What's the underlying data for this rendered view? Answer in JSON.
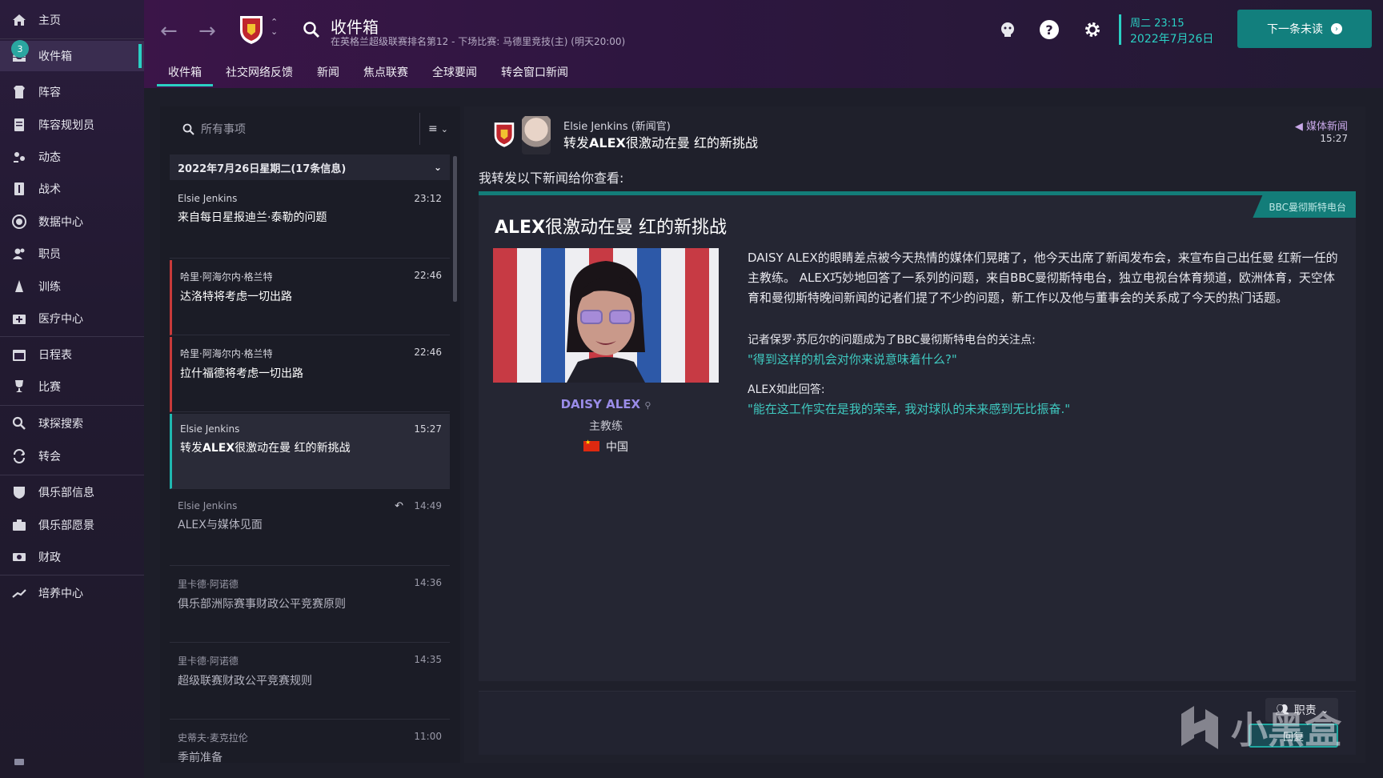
{
  "sidebar": {
    "items": [
      {
        "label": "主页",
        "icon": "home-icon"
      },
      {
        "label": "收件箱",
        "icon": "inbox-icon",
        "badge": "3",
        "active": true
      },
      {
        "label": "阵容",
        "icon": "squad-icon"
      },
      {
        "label": "阵容规划员",
        "icon": "planner-icon"
      },
      {
        "label": "动态",
        "icon": "dynamics-icon"
      },
      {
        "label": "战术",
        "icon": "tactics-icon"
      },
      {
        "label": "数据中心",
        "icon": "data-hub-icon"
      },
      {
        "label": "职员",
        "icon": "staff-icon"
      },
      {
        "label": "训练",
        "icon": "training-icon"
      },
      {
        "label": "医疗中心",
        "icon": "medical-icon"
      },
      {
        "label": "日程表",
        "icon": "calendar-icon"
      },
      {
        "label": "比赛",
        "icon": "trophy-icon"
      },
      {
        "label": "球探搜索",
        "icon": "scouting-icon"
      },
      {
        "label": "转会",
        "icon": "transfer-icon"
      },
      {
        "label": "俱乐部信息",
        "icon": "club-info-icon"
      },
      {
        "label": "俱乐部愿景",
        "icon": "club-vision-icon"
      },
      {
        "label": "财政",
        "icon": "finance-icon"
      },
      {
        "label": "培养中心",
        "icon": "development-icon"
      }
    ]
  },
  "header": {
    "title": "收件箱",
    "subtitle": "在英格兰超级联赛排名第12 - 下场比赛: 马德里竞技(主) (明天20:00)",
    "tabs": [
      "收件箱",
      "社交网络反馈",
      "新闻",
      "焦点联赛",
      "全球要闻",
      "转会窗口新闻"
    ],
    "active_tab": "收件箱",
    "date_line1": "周二 23:15",
    "date_line2": "2022年7月26日",
    "next_button": "下一条未读"
  },
  "inbox": {
    "search_placeholder": "所有事项",
    "group_header": "2022年7月26日星期二(17条信息)",
    "messages": [
      {
        "from": "Elsie Jenkins",
        "subject": "来自每日星报迪兰·泰勒的问题",
        "time": "23:12",
        "state": "new"
      },
      {
        "from": "哈里·阿海尔内·格兰特",
        "subject": "达洛特将考虑一切出路",
        "time": "22:46",
        "state": "unread"
      },
      {
        "from": "哈里·阿海尔内·格兰特",
        "subject": "拉什福德将考虑一切出路",
        "time": "22:46",
        "state": "unread"
      },
      {
        "from": "Elsie Jenkins",
        "subject_pre": "转发",
        "subject_bold": "ALEX",
        "subject_post": "很激动在曼 红的新挑战",
        "time": "15:27",
        "state": "selected"
      },
      {
        "from": "Elsie Jenkins",
        "subject": "ALEX与媒体见面",
        "time": "14:49",
        "state": "read",
        "replied": true
      },
      {
        "from": "里卡德·阿诺德",
        "subject": "俱乐部洲际赛事财政公平竞赛原则",
        "time": "14:36",
        "state": "read"
      },
      {
        "from": "里卡德·阿诺德",
        "subject": "超级联赛财政公平竞赛规则",
        "time": "14:35",
        "state": "read"
      },
      {
        "from": "史蒂夫·麦克拉伦",
        "subject": "季前准备",
        "time": "11:00",
        "state": "read"
      }
    ]
  },
  "message": {
    "from": "Elsie Jenkins (新闻官)",
    "subject_pre": "转发",
    "subject_bold": "ALEX",
    "subject_post": "很激动在曼 红的新挑战",
    "tag": "媒体新闻",
    "time": "15:27",
    "intro": "我转发以下新闻给你查看:",
    "article": {
      "source": "BBC曼彻斯特电台",
      "headline_bold": "ALEX",
      "headline_rest": "很激动在曼 红的新挑战",
      "person_name": "DAISY ALEX",
      "person_role": "主教练",
      "person_nation": "中国",
      "paragraph": "DAISY ALEX的眼睛差点被今天热情的媒体们晃瞎了，他今天出席了新闻发布会，来宣布自己出任曼 红新一任的主教练。 ALEX巧妙地回答了一系列的问题，来自BBC曼彻斯特电台，独立电视台体育频道，欧洲体育，天空体育和曼彻斯特晚间新闻的记者们提了不少的问题，新工作以及他与董事会的关系成了今天的热门话题。",
      "question_label": "记者保罗·苏厄尔的问题成为了BBC曼彻斯特电台的关注点:",
      "question": "\"得到这样的机会对你来说意味着什么?\"",
      "answer_label": "ALEX如此回答:",
      "answer": "\"能在这工作实在是我的荣幸, 我对球队的未来感到无比振奋.\""
    },
    "role_button": "职责",
    "reply_button": "回复"
  },
  "watermark": "小黑盒",
  "colors": {
    "accent": "#2ad0c4",
    "unread": "#c83a3a",
    "button": "#127f7d"
  }
}
